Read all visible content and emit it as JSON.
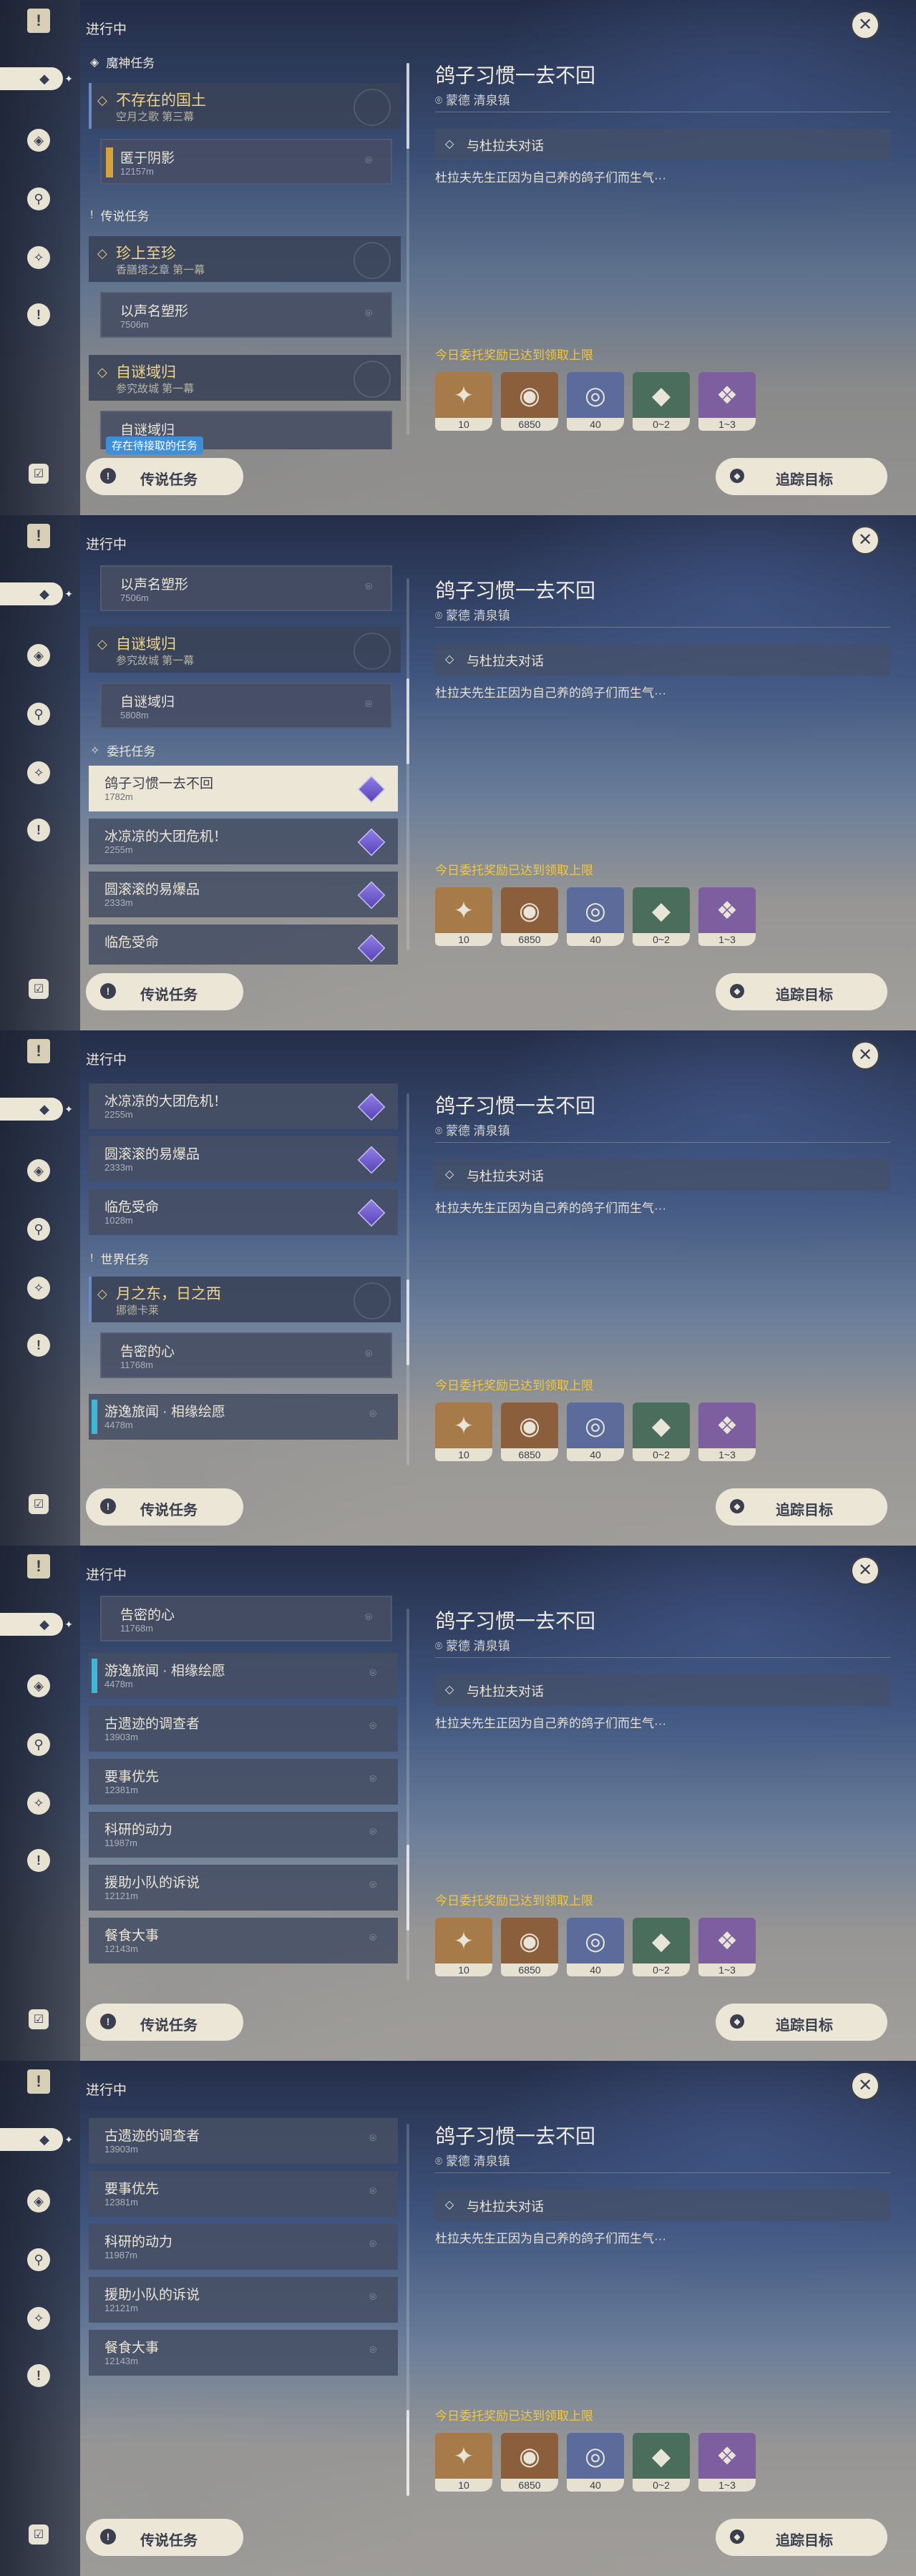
{
  "common": {
    "in_progress": "进行中",
    "close_icon": "✕",
    "legend_button": "传说任务",
    "track_button": "追踪目标",
    "quest_title": "鸽子习惯一去不回",
    "quest_location": "蒙德 清泉镇",
    "objective": "与杜拉夫对话",
    "description": "杜拉夫先生正因为自己养的鸽子们而生气···",
    "reward_note": "今日委托奖励已达到领取上限",
    "rewards": [
      {
        "name": "adventure-exp-icon",
        "count": "10"
      },
      {
        "name": "mora-icon",
        "count": "6850"
      },
      {
        "name": "companionship-exp-icon",
        "count": "40"
      },
      {
        "name": "crystal-chunk-icon",
        "count": "0~2"
      },
      {
        "name": "crystal-chunk-large-icon",
        "count": "1~3"
      }
    ]
  },
  "frame1": {
    "tooltip": "存在待接取的任务",
    "group1": "魔神任务",
    "p1_title": "不存在的国土",
    "p1_sub": "空月之歌 第三幕",
    "c1_title": "匿于阴影",
    "c1_sub": "12157m",
    "group2": "传说任务",
    "p2_title": "珍上至珍",
    "p2_sub": "香膳塔之章 第一幕",
    "c2_title": "以声名塑形",
    "c2_sub": "7506m",
    "p3_title": "自谜域归",
    "p3_sub": "参究故城 第一幕",
    "c3_title": "自谜域归"
  },
  "frame2": {
    "c1_title": "以声名塑形",
    "c1_sub": "7506m",
    "p1_title": "自谜域归",
    "p1_sub": "参究故城 第一幕",
    "c2_title": "自谜域归",
    "c2_sub": "5808m",
    "group": "委托任务",
    "i1_title": "鸽子习惯一去不回",
    "i1_sub": "1782m",
    "i2_title": "冰凉凉的大团危机！",
    "i2_sub": "2255m",
    "i3_title": "圆滚滚的易爆品",
    "i3_sub": "2333m",
    "i4_title": "临危受命"
  },
  "frame3": {
    "i1_title": "冰凉凉的大团危机！",
    "i1_sub": "2255m",
    "i2_title": "圆滚滚的易爆品",
    "i2_sub": "2333m",
    "i3_title": "临危受命",
    "i3_sub": "1028m",
    "group": "世界任务",
    "p1_title": "月之东，日之西",
    "p1_sub": "挪德卡莱",
    "c1_title": "告密的心",
    "c1_sub": "11768m",
    "i4_title": "游逸旅闻 · 相缘绘愿",
    "i4_sub": "4478m"
  },
  "frame4": {
    "c1_title": "告密的心",
    "c1_sub": "11768m",
    "i1_title": "游逸旅闻 · 相缘绘愿",
    "i1_sub": "4478m",
    "i2_title": "古遗迹的调查者",
    "i2_sub": "13903m",
    "i3_title": "要事优先",
    "i3_sub": "12381m",
    "i4_title": "科研的动力",
    "i4_sub": "11987m",
    "i5_title": "援助小队的诉说",
    "i5_sub": "12121m",
    "i6_title": "餐食大事",
    "i6_sub": "12143m"
  },
  "frame5": {
    "i1_title": "古遗迹的调查者",
    "i1_sub": "13903m",
    "i2_title": "要事优先",
    "i2_sub": "12381m",
    "i3_title": "科研的动力",
    "i3_sub": "11987m",
    "i4_title": "援助小队的诉说",
    "i4_sub": "12121m",
    "i5_title": "餐食大事",
    "i5_sub": "12143m"
  }
}
